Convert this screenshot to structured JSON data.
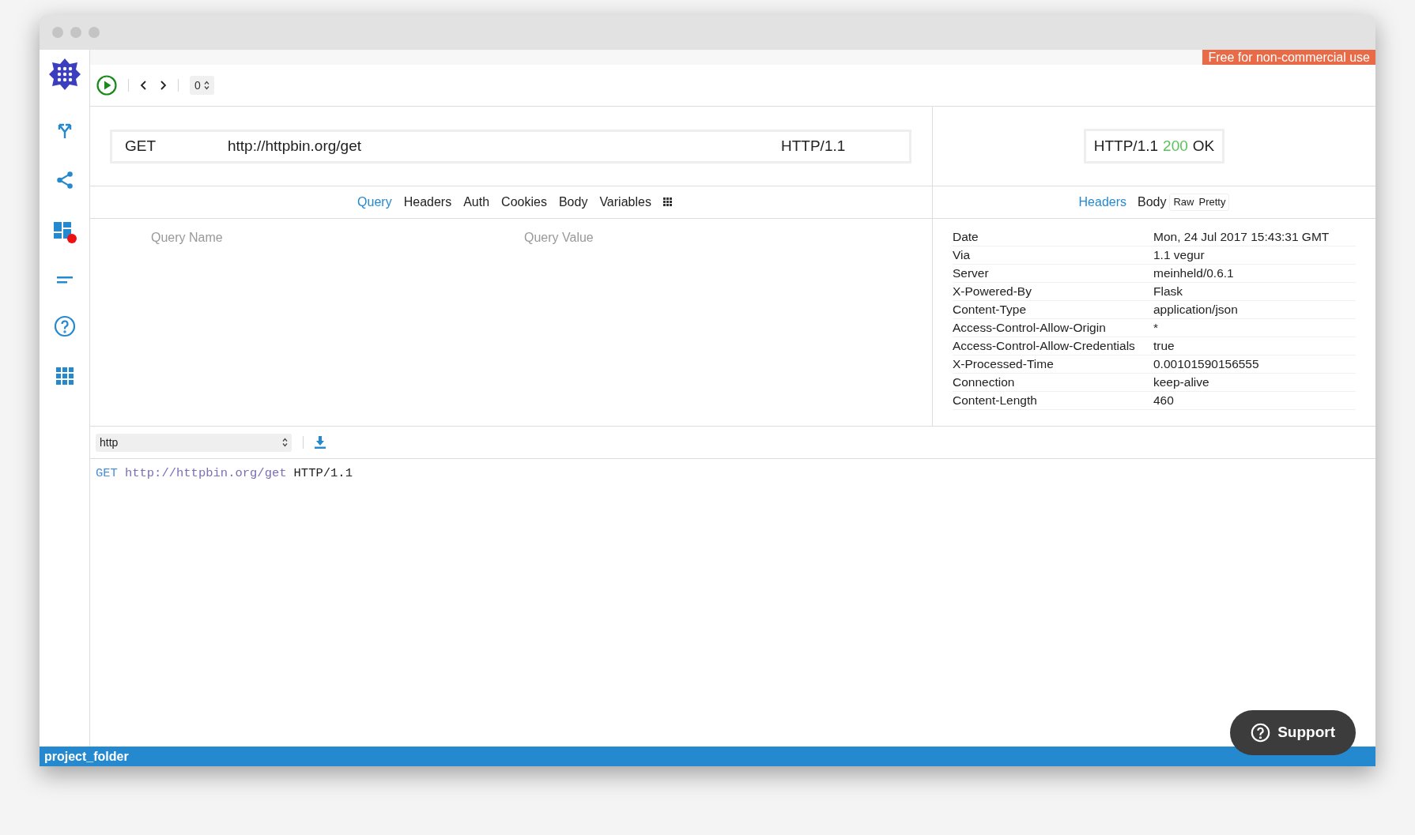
{
  "banner": "Free for non-commercial use",
  "toolbar": {
    "history_index": "0"
  },
  "request": {
    "method": "GET",
    "url": "http://httpbin.org/get",
    "version": "HTTP/1.1"
  },
  "response_status": {
    "version": "HTTP/1.1",
    "code": "200",
    "text": "OK"
  },
  "request_tabs": [
    {
      "label": "Query",
      "selected": true
    },
    {
      "label": "Headers",
      "selected": false
    },
    {
      "label": "Auth",
      "selected": false
    },
    {
      "label": "Cookies",
      "selected": false
    },
    {
      "label": "Body",
      "selected": false
    },
    {
      "label": "Variables",
      "selected": false
    }
  ],
  "query_table": {
    "columns": [
      "Query Name",
      "Query Value"
    ]
  },
  "response_tabs": [
    {
      "label": "Headers",
      "selected": true
    },
    {
      "label": "Body",
      "selected": false
    }
  ],
  "body_modes": [
    {
      "label": "Raw",
      "selected": false
    },
    {
      "label": "Pretty",
      "selected": false
    }
  ],
  "response_headers": [
    {
      "name": "Date",
      "value": "Mon, 24 Jul 2017 15:43:31 GMT"
    },
    {
      "name": "Via",
      "value": "1.1 vegur"
    },
    {
      "name": "Server",
      "value": "meinheld/0.6.1"
    },
    {
      "name": "X-Powered-By",
      "value": "Flask"
    },
    {
      "name": "Content-Type",
      "value": "application/json"
    },
    {
      "name": "Access-Control-Allow-Origin",
      "value": "*"
    },
    {
      "name": "Access-Control-Allow-Credentials",
      "value": "true"
    },
    {
      "name": "X-Processed-Time",
      "value": "0.00101590156555"
    },
    {
      "name": "Connection",
      "value": "keep-alive"
    },
    {
      "name": "Content-Length",
      "value": "460"
    }
  ],
  "code_format": {
    "value": "http"
  },
  "code_tokens": [
    {
      "kind": "method",
      "text": "GET"
    },
    {
      "kind": "url",
      "text": "http://httpbin.org/get"
    },
    {
      "kind": "plain",
      "text": "HTTP/1.1"
    }
  ],
  "support_button": "Support",
  "status_bar": {
    "project": "project_folder"
  }
}
